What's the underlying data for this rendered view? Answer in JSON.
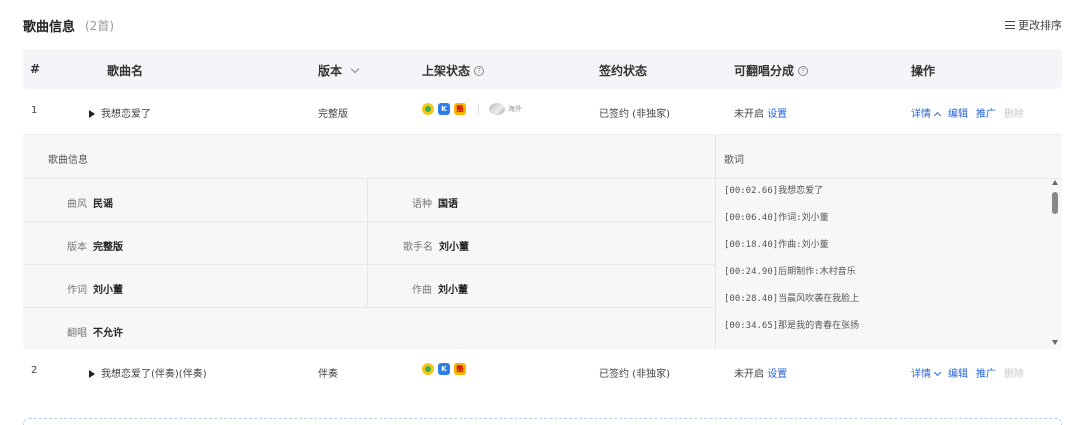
{
  "header": {
    "title": "歌曲信息",
    "count": "(2首)",
    "sort_label": "更改排序"
  },
  "columns": {
    "index": "#",
    "name": "歌曲名",
    "version": "版本",
    "listing_status": "上架状态",
    "sign_status": "签约状态",
    "cover_share": "可翻唱分成",
    "actions": "操作"
  },
  "rows": [
    {
      "index": "1",
      "name": "我想恋爱了",
      "version": "完整版",
      "overseas": "海外",
      "sign_status": "已签约 (非独家)",
      "cover_status": "未开启",
      "cover_link": "设置",
      "detail": "详情",
      "edit": "编辑",
      "promote": "推广",
      "delete": "删除"
    },
    {
      "index": "2",
      "name": "我想恋爱了(伴奏)(伴奏)",
      "version": "伴奏",
      "sign_status": "已签约 (非独家)",
      "cover_status": "未开启",
      "cover_link": "设置",
      "detail": "详情",
      "edit": "编辑",
      "promote": "推广",
      "delete": "删除"
    }
  ],
  "detail": {
    "info_heading": "歌曲信息",
    "lyrics_heading": "歌词",
    "fields": {
      "genre_k": "曲风",
      "genre_v": "民谣",
      "lang_k": "语种",
      "lang_v": "国语",
      "version_k": "版本",
      "version_v": "完整版",
      "singer_k": "歌手名",
      "singer_v": "刘小董",
      "lyricist_k": "作词",
      "lyricist_v": "刘小董",
      "composer_k": "作曲",
      "composer_v": "刘小董",
      "cover_k": "翻唱",
      "cover_v": "不允许"
    },
    "lyrics": [
      "[00:02.66]我想恋爱了",
      "[00:06.40]作词:刘小董",
      "[00:18.40]作曲:刘小董",
      "[00:24.90]后期制作:木村音乐",
      "[00:28.40]当晨风吹袭在我脸上",
      "[00:34.65]那是我的青春在张扬"
    ]
  },
  "colors": {
    "link": "#2563d9",
    "header_bg": "#f4f5f8",
    "detail_bg": "#f7f7f8"
  }
}
